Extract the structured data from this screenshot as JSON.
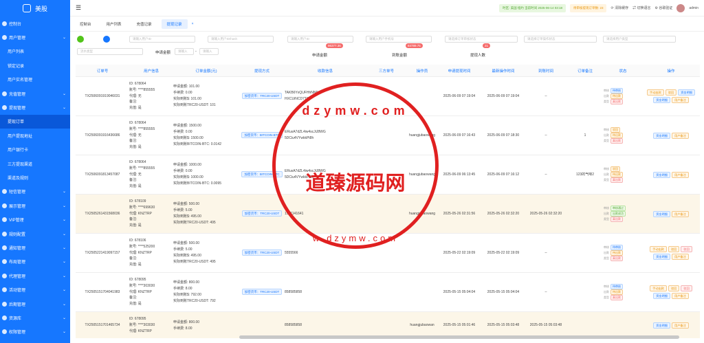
{
  "app": {
    "name": "美股"
  },
  "sidebar": {
    "items": [
      {
        "label": "控制台",
        "sub": false
      },
      {
        "label": "用户管理",
        "sub": false
      },
      {
        "label": "用户列表",
        "sub": true
      },
      {
        "label": "锁定记录",
        "sub": true
      },
      {
        "label": "用户实名管理",
        "sub": true
      },
      {
        "label": "充值管理",
        "sub": false
      },
      {
        "label": "提现管理",
        "sub": false
      },
      {
        "label": "提现订单",
        "sub": true,
        "active": true
      },
      {
        "label": "用户提现地址",
        "sub": true
      },
      {
        "label": "用户银行卡",
        "sub": true
      },
      {
        "label": "三方提现渠道",
        "sub": true
      },
      {
        "label": "渠道及规则",
        "sub": true
      },
      {
        "label": "短信管理",
        "sub": false
      },
      {
        "label": "展示管理",
        "sub": false
      },
      {
        "label": "VIP管理",
        "sub": false
      },
      {
        "label": "规则配置",
        "sub": false
      },
      {
        "label": "通知管理",
        "sub": false
      },
      {
        "label": "布局管理",
        "sub": false
      },
      {
        "label": "代理管理",
        "sub": false
      },
      {
        "label": "活动管理",
        "sub": false
      },
      {
        "label": "后期管理",
        "sub": false
      },
      {
        "label": "资源库",
        "sub": false
      },
      {
        "label": "权限管理",
        "sub": false
      }
    ]
  },
  "topbar": {
    "time": "时区: 美国 纽约 当前时间 2025-06-14 03:18",
    "pending": "待审核提现订单数: 23",
    "clear_cache": "清除缓存",
    "switch_lang": "切换语言",
    "google_auth": "谷歌验证",
    "user": "admin"
  },
  "tabs": [
    {
      "label": "控制台"
    },
    {
      "label": "用户列表"
    },
    {
      "label": "充值记录"
    },
    {
      "label": "提现记录",
      "active": true
    }
  ],
  "filters": {
    "user_id": "请输入用户ID",
    "user_name": "请输入用户ID/hash",
    "user_account": "请输入用户ID",
    "chain_account": "请输入用户手机号",
    "order_status": "请选择订单审核状态",
    "withdraw_status": "请选择订单操作状态",
    "user_type": "请选择用户类型",
    "flow_type": "流水类型",
    "apply_amount_label": "申请金额",
    "min": "请输入",
    "max": "请输入",
    "apply_total_label": "申请金额",
    "apply_total": "96377.36",
    "arrive_total_label": "到账金额",
    "arrive_total": "84789.75",
    "count_label": "提现人数",
    "count": "21"
  },
  "table": {
    "headers": [
      "订单号",
      "用户信息",
      "订单金额(元)",
      "提现方式",
      "收款信息",
      "三方单号",
      "操作员",
      "申请提现时间",
      "最新操作时间",
      "到账时间",
      "订单备注",
      "状态",
      "操作"
    ],
    "rows": [
      {
        "id": "TX2506091919046031",
        "user": [
          "ID: 678064",
          "账号: ****855555",
          "代理: 无",
          "备注:",
          "充值: 是"
        ],
        "amount": [
          "申请金额: 101.00",
          "手续费: 0.00",
          "实际到账$: 101.00",
          "实际到账TRC20-USDT: 101"
        ],
        "method": "加密货币：TRC20-USDT",
        "recv": [
          "TAKB6YxQUFHhNNEm",
          "HXCUiNCD7T8S"
        ],
        "third": "",
        "op": "",
        "apply": "2025-06-09 07:19:04",
        "update": "2025-06-09 07:19:04",
        "arrive": "--",
        "note": "",
        "status": [
          [
            "审核",
            "待审核",
            "b"
          ],
          [
            "出款",
            "待出款",
            "o"
          ],
          [
            "类型",
            "真出款",
            "r"
          ]
        ],
        "ops": [
          [
            "手动出款",
            "o"
          ],
          [
            "驳回",
            "o"
          ],
          [
            "资金明细",
            "b"
          ],
          [
            "资金明细",
            "b"
          ],
          [
            "用户备注",
            "o"
          ]
        ],
        "hl": false
      },
      {
        "id": "TX2506091916436686",
        "user": [
          "ID: 678064",
          "账号: ****855555",
          "代理: 无",
          "备注:",
          "充值: 是"
        ],
        "amount": [
          "申请金额: 1500.00",
          "手续费: 0.00",
          "实际到账$: 1500.00",
          "实际到账BITCOIN-BTC: 0.0142"
        ],
        "method": "加密货币：BITCOIN-BTC",
        "recv": [
          "ERuxA7dZL4iw4scJiJ8WG",
          "5DCiu4VYwkkPt8h"
        ],
        "third": "",
        "op": "huangjubaowang",
        "apply": "2025-06-09 07:16:43",
        "update": "2025-06-09 07:18:30",
        "arrive": "--",
        "note": "1",
        "status": [
          [
            "审核",
            "驳回",
            "o"
          ],
          [
            "出款",
            "待出款",
            "o"
          ],
          [
            "类型",
            "真出款",
            "r"
          ]
        ],
        "ops": [
          [
            "资金明细",
            "b"
          ],
          [
            "用户备注",
            "o"
          ]
        ],
        "hl": false
      },
      {
        "id": "TX2506091813457087",
        "user": [
          "ID: 678064",
          "账号: ****855555",
          "代理: 无",
          "备注:",
          "充值: 是"
        ],
        "amount": [
          "申请金额: 1000.00",
          "手续费: 0.00",
          "实际到账$: 1000.00",
          "实际到账BITCOIN-BTC: 0.0095"
        ],
        "method": "加密货币：BITCOIN-BTC",
        "recv": [
          "ERuxA7dZL4iw4scJiJ8WG",
          "5DCiu4VYwkkPt8h"
        ],
        "third": "",
        "op": "huangjubaowang",
        "apply": "2025-06-09 06:13:45",
        "update": "2025-06-09 07:16:12",
        "arrive": "--",
        "note": "123的气味2",
        "status": [
          [
            "审核",
            "驳回",
            "o"
          ],
          [
            "出款",
            "待出款",
            "o"
          ],
          [
            "类型",
            "真出款",
            "r"
          ]
        ],
        "ops": [
          [
            "资金明细",
            "b"
          ],
          [
            "用户备注",
            "o"
          ]
        ],
        "hl": false
      },
      {
        "id": "TX2505261431568036",
        "user": [
          "ID: 678109",
          "账号: ****699630",
          "代理: KNZTRP",
          "备注:",
          "充值: 是"
        ],
        "amount": [
          "申请金额: 500.00",
          "手续费: 5.00",
          "实际到账$: 495.00",
          "实际到账TRC20-USDT: 495"
        ],
        "method": "加密货币：TRC20-USDT",
        "recv": [
          "1561141641"
        ],
        "third": "",
        "op": "huangjubaowang",
        "apply": "2025-05-26 02:31:56",
        "update": "2025-05-26 02:32:20",
        "arrive": "2025-05-26 02:32:20",
        "note": "",
        "status": [
          [
            "审核",
            "审核通过",
            "g"
          ],
          [
            "出款",
            "出款成功",
            "g"
          ],
          [
            "类型",
            "真出款",
            "r"
          ]
        ],
        "ops": [
          [
            "资金明细",
            "b"
          ],
          [
            "用户备注",
            "o"
          ]
        ],
        "hl": true
      },
      {
        "id": "TX2505221419097157",
        "user": [
          "ID: 678106",
          "账号: ****525200",
          "代理: KNZTRP",
          "备注:",
          "充值: 是"
        ],
        "amount": [
          "申请金额: 500.00",
          "手续费: 5.00",
          "实际到账$: 495.00",
          "实际到账TRC20-USDT: 495"
        ],
        "method": "加密货币：TRC20-USDT",
        "recv": [
          "5555566"
        ],
        "third": "",
        "op": "",
        "apply": "2025-05-22 02:19:09",
        "update": "2025-05-22 02:19:09",
        "arrive": "--",
        "note": "",
        "status": [
          [
            "审核",
            "待审核",
            "b"
          ],
          [
            "出款",
            "待出款",
            "o"
          ],
          [
            "类型",
            "真出款",
            "r"
          ]
        ],
        "ops": [
          [
            "手动出款",
            "o"
          ],
          [
            "驳回",
            "o"
          ],
          [
            "驳回",
            "r"
          ],
          [
            "资金明细",
            "b"
          ],
          [
            "用户备注",
            "o"
          ]
        ],
        "hl": false
      },
      {
        "id": "TX2505151704041983",
        "user": [
          "ID: 678095",
          "账号: ****303030",
          "代理: KNZTRP",
          "备注:",
          "充值: 是"
        ],
        "amount": [
          "申请金额: 800.00",
          "手续费: 8.00",
          "实际到账$: 792.00",
          "实际到账TRC20-USDT: 792"
        ],
        "method": "加密货币：TRC20-USDT",
        "recv": [
          "858585858"
        ],
        "third": "",
        "op": "",
        "apply": "2025-05-15 05:04:04",
        "update": "2025-05-15 05:04:04",
        "arrive": "--",
        "note": "",
        "status": [
          [
            "审核",
            "待审核",
            "b"
          ],
          [
            "出款",
            "待出款",
            "o"
          ],
          [
            "类型",
            "真出款",
            "r"
          ]
        ],
        "ops": [
          [
            "手动出款",
            "o"
          ],
          [
            "驳回",
            "o"
          ],
          [
            "驳回",
            "r"
          ],
          [
            "资金明细",
            "b"
          ],
          [
            "用户备注",
            "o"
          ]
        ],
        "hl": false
      },
      {
        "id": "TX2505151701465734",
        "user": [
          "ID: 678095",
          "账号: ****303030",
          "代理: KNZTRP"
        ],
        "amount": [
          "申请金额: 800.00",
          "手续费: 8.00"
        ],
        "method": "",
        "recv": [
          "858585858"
        ],
        "third": "",
        "op": "huangjubaowan",
        "apply": "2025-05-15 05:01:46",
        "update": "2025-05-15 05:03:48",
        "arrive": "2025-05-15 05:03:48",
        "note": "",
        "status": [],
        "ops": [
          [
            "资金明细",
            "b"
          ],
          [
            "用户备注",
            "o"
          ]
        ],
        "hl": true
      }
    ]
  },
  "watermark": {
    "text": "道臻源码网",
    "top": "dzymw.com",
    "bottom": "w.dzymw.com"
  }
}
